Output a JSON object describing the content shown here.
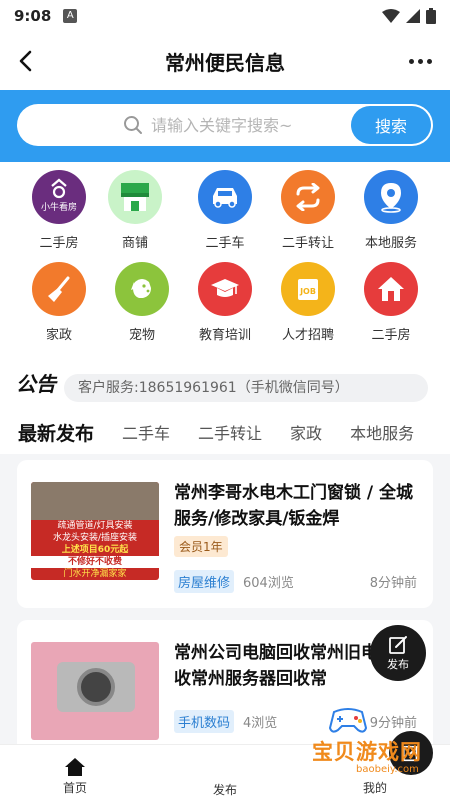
{
  "status_bar": {
    "time": "9:08",
    "notif_letter": "A"
  },
  "header": {
    "title": "常州便民信息"
  },
  "search": {
    "placeholder": "请输入关键字搜索~",
    "button_label": "搜索"
  },
  "categories": [
    {
      "label": "二手房",
      "icon": "house-app-icon",
      "color": "#6a2d7e",
      "badge": "小牛看房"
    },
    {
      "label": "商铺",
      "icon": "storefront-icon",
      "color": "#bff0c0"
    },
    {
      "label": "二手车",
      "icon": "car-icon",
      "color": "#2e7fe6"
    },
    {
      "label": "二手转让",
      "icon": "exchange-icon",
      "color": "#f27a2c"
    },
    {
      "label": "本地服务",
      "icon": "location-pin-icon",
      "color": "#2e7fe6"
    },
    {
      "label": "家政",
      "icon": "broom-icon",
      "color": "#f27a2c"
    },
    {
      "label": "宠物",
      "icon": "dog-icon",
      "color": "#8cc43c"
    },
    {
      "label": "教育培训",
      "icon": "graduation-cap-icon",
      "color": "#e63c3c"
    },
    {
      "label": "人才招聘",
      "icon": "job-icon",
      "color": "#f4b41a"
    },
    {
      "label": "二手房",
      "icon": "home-icon",
      "color": "#e63c3c"
    }
  ],
  "notice": {
    "logo": "公告",
    "text": "客户服务:18651961961（手机微信同号）"
  },
  "tabs": [
    "最新发布",
    "二手车",
    "二手转让",
    "家政",
    "本地服务"
  ],
  "posts": [
    {
      "title": "常州李哥水电木工门窗锁 / 全城服务/修改家具/钣金焊",
      "member": "会员1年",
      "tag": "房屋维修",
      "views": "604浏览",
      "time": "8分钟前",
      "thumb_lines": [
        "疏通管道/灯具安装",
        "水龙头安装/插座安装",
        "上述项目60元起",
        "不修好不收费",
        "门水开净漏家家"
      ]
    },
    {
      "title": "常州公司电脑回收常州旧电脑回收常州服务器回收常",
      "tag": "手机数码",
      "views": "4浏览",
      "time": "9分钟前"
    }
  ],
  "float_post": {
    "label": "发布"
  },
  "bottom_nav": {
    "home": "首页",
    "post": "发布",
    "mine": "我的"
  },
  "watermark": {
    "text": "宝贝游戏网",
    "url": "baobeiy.com"
  }
}
